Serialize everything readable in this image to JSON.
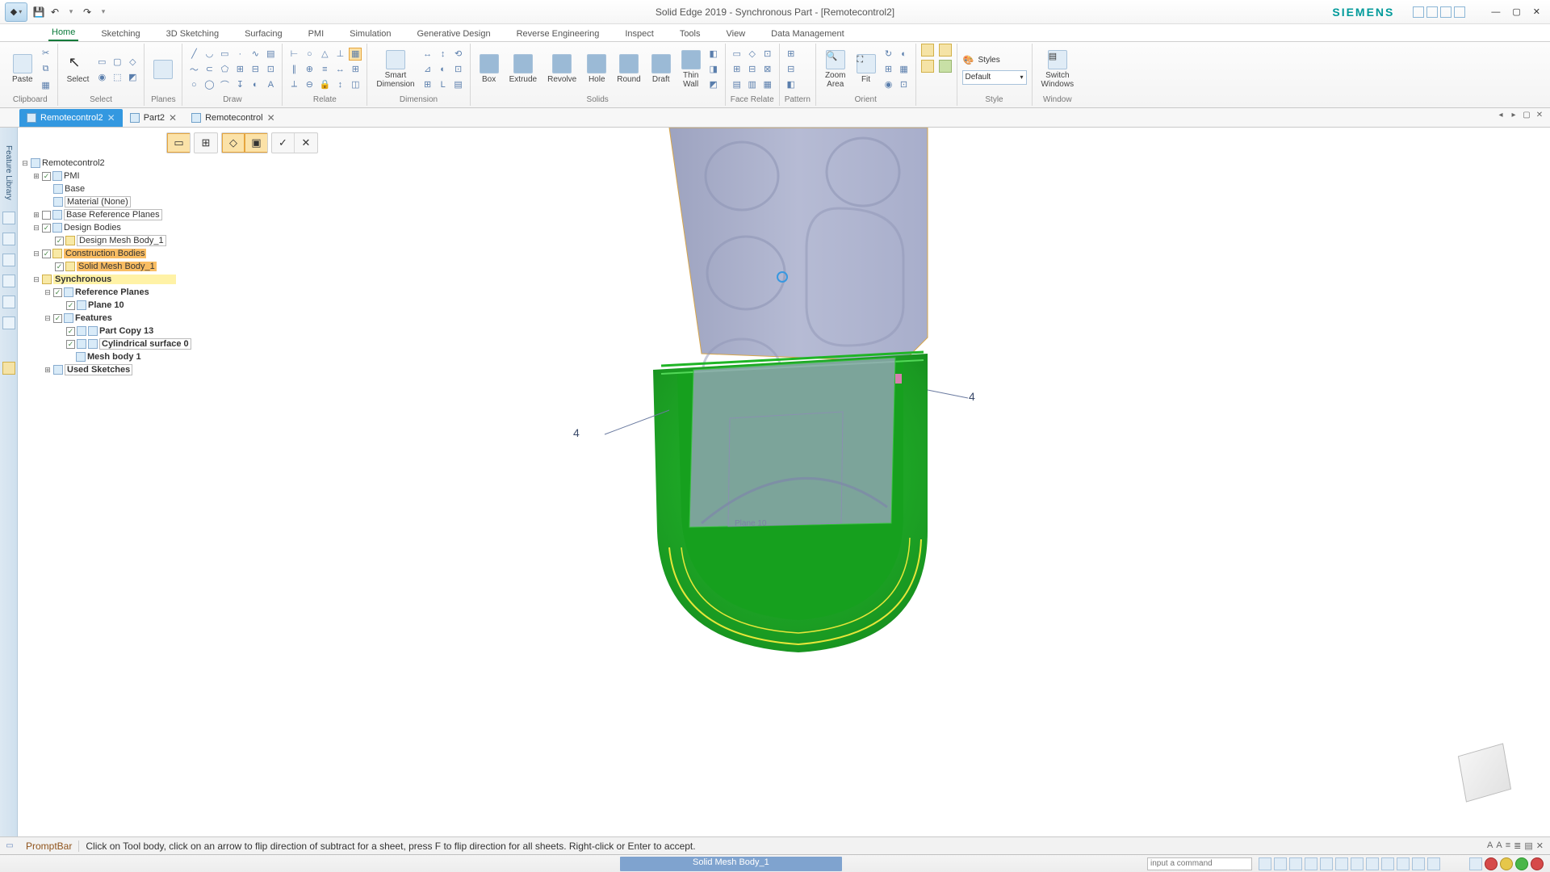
{
  "app": {
    "title": "Solid Edge 2019 - Synchronous Part - [Remotecontrol2]",
    "brand": "SIEMENS"
  },
  "qat": {
    "save": "💾",
    "undo": "↶",
    "redo": "↷",
    "more": "▾"
  },
  "ribbon_tabs": [
    "Home",
    "Sketching",
    "3D Sketching",
    "Surfacing",
    "PMI",
    "Simulation",
    "Generative Design",
    "Reverse Engineering",
    "Inspect",
    "Tools",
    "View",
    "Data Management"
  ],
  "active_ribbon_tab": 0,
  "ribbon": {
    "paste": "Paste",
    "clipboard": "Clipboard",
    "select": "Select",
    "select_grp": "Select",
    "planes": "Planes",
    "draw": "Draw",
    "relate": "Relate",
    "smartdim": "Smart\nDimension",
    "dimension": "Dimension",
    "box": "Box",
    "extrude": "Extrude",
    "revolve": "Revolve",
    "hole": "Hole",
    "round": "Round",
    "draft": "Draft",
    "thinwall": "Thin\nWall",
    "solids": "Solids",
    "facerel": "Face Relate",
    "pattern": "Pattern",
    "zoomarea": "Zoom\nArea",
    "fit": "Fit",
    "orient": "Orient",
    "styles": "Styles",
    "style_default": "Default",
    "style": "Style",
    "switchwin": "Switch\nWindows",
    "window": "Window"
  },
  "doc_tabs": [
    {
      "label": "Remotecontrol2",
      "active": true
    },
    {
      "label": "Part2",
      "active": false
    },
    {
      "label": "Remotecontrol",
      "active": false
    }
  ],
  "left_rail": "Feature Library",
  "tree": {
    "root": "Remotecontrol2",
    "pmi": "PMI",
    "base": "Base",
    "material": "Material (None)",
    "baseplanes": "Base Reference Planes",
    "designbodies": "Design Bodies",
    "designmeshbody": "Design Mesh Body_1",
    "construction": "Construction Bodies",
    "solidmesh": "Solid Mesh Body_1",
    "sync": "Synchronous",
    "refplanes": "Reference Planes",
    "plane10": "Plane 10",
    "features": "Features",
    "partcopy": "Part Copy 13",
    "cylsurf": "Cylindrical surface 0",
    "meshbody1": "Mesh body 1",
    "usedsketches": "Used Sketches"
  },
  "annotations": {
    "left": "4",
    "right": "4",
    "plane_label": "Plane 10"
  },
  "prompt": {
    "label": "PromptBar",
    "text": "Click on Tool body, click on an arrow to flip direction of subtract for a sheet, press F to flip direction for all sheets.  Right-click or Enter to accept."
  },
  "status": {
    "highlight": "Solid Mesh Body_1",
    "cmd_placeholder": "input a command"
  },
  "style_dropdown": "Default"
}
